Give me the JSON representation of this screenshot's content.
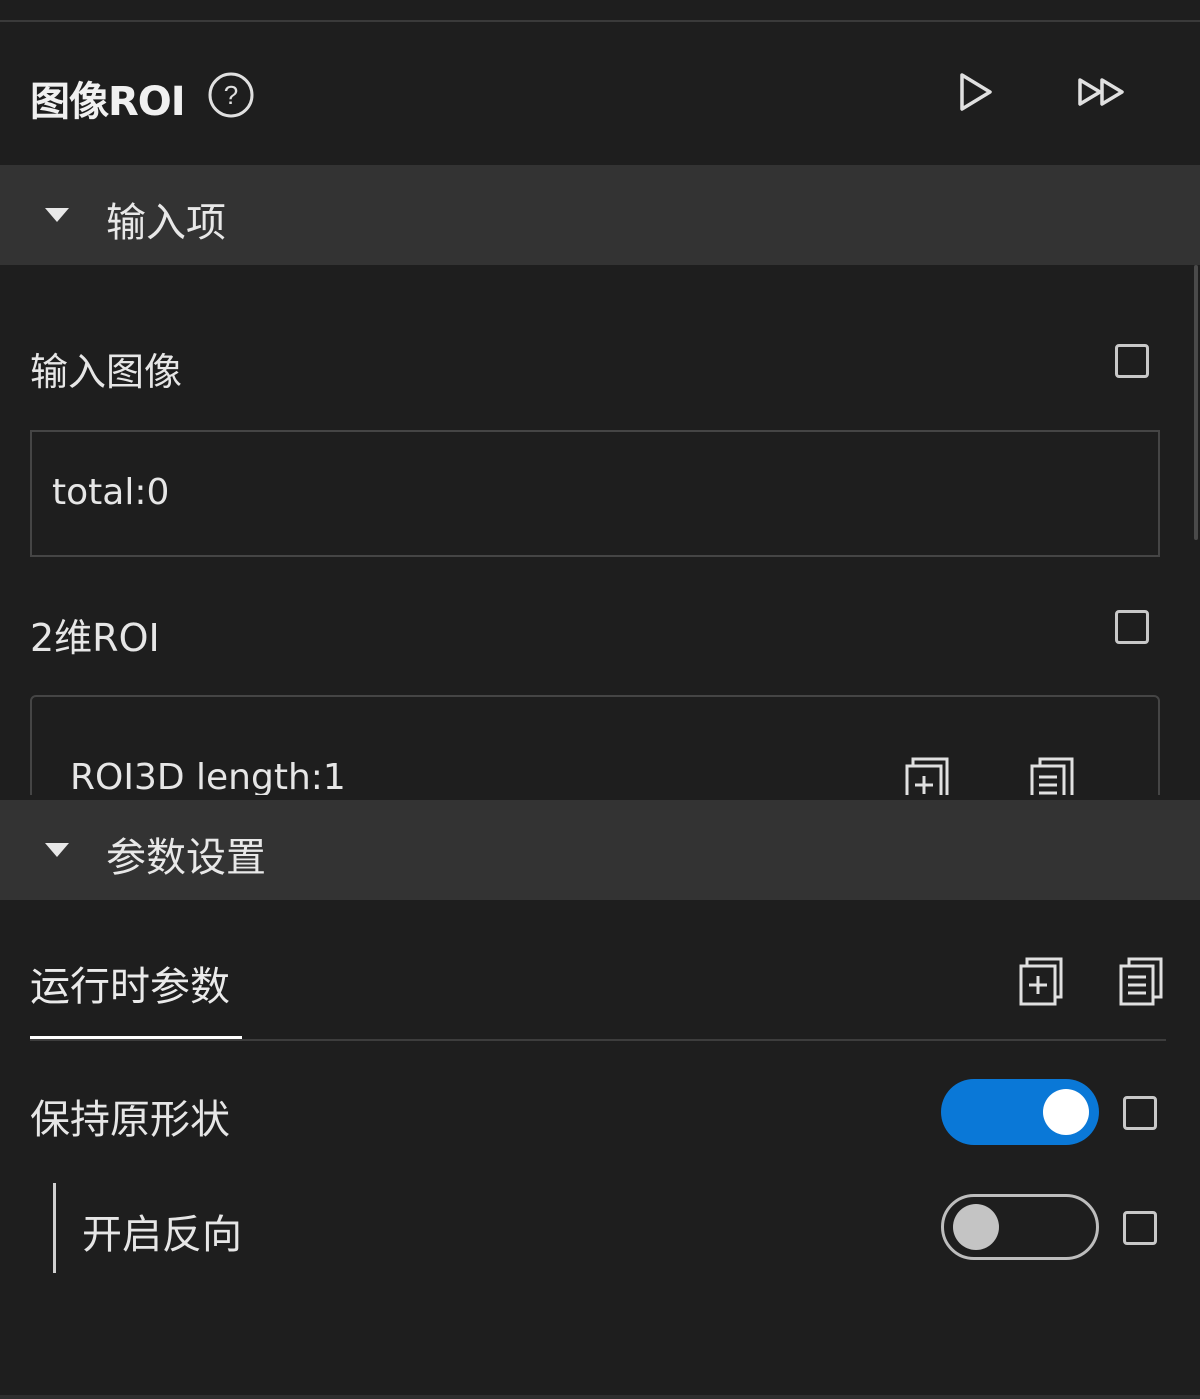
{
  "panel": {
    "title": "图像ROI",
    "help_icon": "help-circle-icon",
    "run_icon": "play-icon",
    "run_all_icon": "fast-forward-icon"
  },
  "sections": {
    "inputs": {
      "label": "输入项"
    },
    "params": {
      "label": "参数设置"
    }
  },
  "inputs": {
    "image": {
      "label": "输入图像",
      "value": "total:0"
    },
    "roi2d": {
      "label": "2维ROI",
      "value": "ROI3D length:1"
    }
  },
  "params": {
    "tab": "运行时参数",
    "keep_shape": {
      "label": "保持原形状",
      "on": true
    },
    "reverse": {
      "label": "开启反向",
      "on": false
    }
  },
  "colors": {
    "background": "#1e1e1e",
    "section_header": "#333333",
    "accent": "#0a78d7"
  }
}
